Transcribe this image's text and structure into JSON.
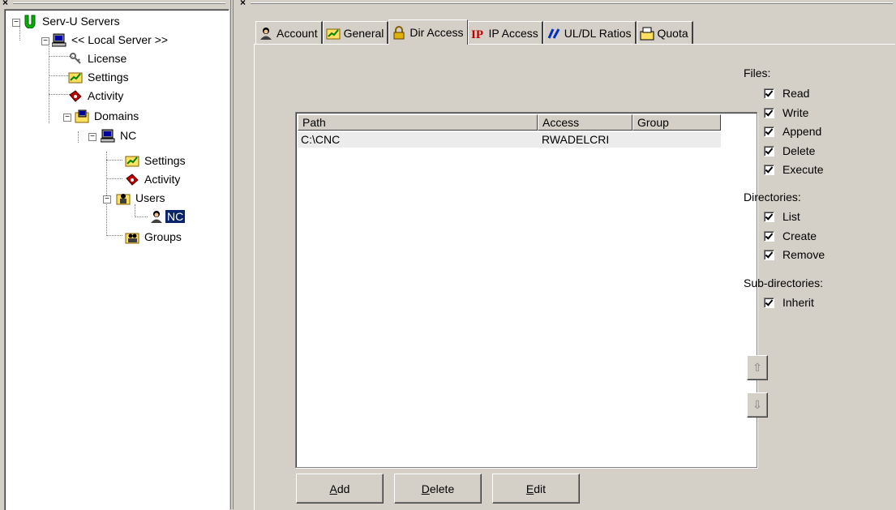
{
  "tree": {
    "items": [
      {
        "label": "Serv-U Servers",
        "icon": "servu-logo-icon",
        "expander": "minus"
      },
      {
        "label": "<< Local Server >>",
        "icon": "computer-icon",
        "expander": "minus"
      },
      {
        "label": "License",
        "icon": "keys-icon"
      },
      {
        "label": "Settings",
        "icon": "settings-folder-icon"
      },
      {
        "label": "Activity",
        "icon": "activity-icon"
      },
      {
        "label": "Domains",
        "icon": "domains-folder-icon",
        "expander": "minus"
      },
      {
        "label": "NC",
        "icon": "computer-icon",
        "expander": "minus"
      },
      {
        "label": "Settings",
        "icon": "settings-folder-icon"
      },
      {
        "label": "Activity",
        "icon": "activity-icon"
      },
      {
        "label": "Users",
        "icon": "users-folder-icon",
        "expander": "minus"
      },
      {
        "label": "NC",
        "icon": "user-icon",
        "selected": true
      },
      {
        "label": "Groups",
        "icon": "groups-folder-icon"
      }
    ]
  },
  "tabs": [
    {
      "label": "Account",
      "icon": "account-icon"
    },
    {
      "label": "General",
      "icon": "general-icon"
    },
    {
      "label": "Dir Access",
      "icon": "lock-icon",
      "active": true
    },
    {
      "label": "IP Access",
      "icon": "ip-icon"
    },
    {
      "label": "UL/DL Ratios",
      "icon": "ratios-icon"
    },
    {
      "label": "Quota",
      "icon": "quota-icon"
    }
  ],
  "dir_list": {
    "columns": [
      "Path",
      "Access",
      "Group"
    ],
    "rows": [
      {
        "path": "C:\\CNC",
        "access": "RWADELCRI",
        "group": ""
      }
    ]
  },
  "buttons": {
    "add": {
      "mnemonic": "A",
      "rest": "dd"
    },
    "delete": {
      "mnemonic": "D",
      "rest": "elete"
    },
    "edit": {
      "mnemonic": "E",
      "rest": "dit"
    }
  },
  "permissions": {
    "files_label": "Files:",
    "files": [
      {
        "label": "Read",
        "checked": true
      },
      {
        "label": "Write",
        "checked": true
      },
      {
        "label": "Append",
        "checked": true
      },
      {
        "label": "Delete",
        "checked": true
      },
      {
        "label": "Execute",
        "checked": true
      }
    ],
    "directories_label": "Directories:",
    "directories": [
      {
        "label": "List",
        "checked": true
      },
      {
        "label": "Create",
        "checked": true
      },
      {
        "label": "Remove",
        "checked": true
      }
    ],
    "subdirectories_label": "Sub-directories:",
    "subdirectories": [
      {
        "label": "Inherit",
        "checked": true
      }
    ]
  },
  "icons": {
    "close": "×",
    "move_up": "⇧",
    "move_down": "⇩"
  },
  "colors": {
    "face": "#d4d0c8",
    "selection": "#0a246a",
    "servu_green": "#00b000"
  }
}
